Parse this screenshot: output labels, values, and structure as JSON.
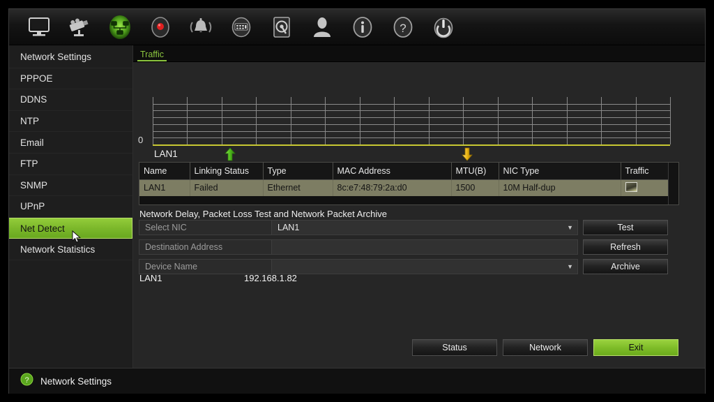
{
  "toolbar": {
    "icons": [
      {
        "name": "monitor-icon",
        "label": "Playback"
      },
      {
        "name": "camera-icon",
        "label": "Camera"
      },
      {
        "name": "network-icon",
        "label": "Network",
        "active": true,
        "accent": "#7ac943"
      },
      {
        "name": "record-icon",
        "label": "Record"
      },
      {
        "name": "alarm-bell-icon",
        "label": "Alarm"
      },
      {
        "name": "device-panel-icon",
        "label": "Device"
      },
      {
        "name": "hdd-icon",
        "label": "HDD"
      },
      {
        "name": "user-icon",
        "label": "User"
      },
      {
        "name": "info-icon",
        "label": "Information"
      },
      {
        "name": "help-icon",
        "label": "Help"
      },
      {
        "name": "power-icon",
        "label": "Shutdown"
      }
    ]
  },
  "sidebar": {
    "items": [
      {
        "label": "Network Settings",
        "active": false
      },
      {
        "label": "PPPOE",
        "active": false
      },
      {
        "label": "DDNS",
        "active": false
      },
      {
        "label": "NTP",
        "active": false
      },
      {
        "label": "Email",
        "active": false
      },
      {
        "label": "FTP",
        "active": false
      },
      {
        "label": "SNMP",
        "active": false
      },
      {
        "label": "UPnP",
        "active": false
      },
      {
        "label": "Net Detect",
        "active": true
      },
      {
        "label": "Network Statistics",
        "active": false
      }
    ],
    "active_color": "#7cb82b"
  },
  "tabs": [
    {
      "label": "Traffic",
      "active": true,
      "color": "#8cc63f"
    }
  ],
  "chart_data": {
    "type": "line",
    "title": "Traffic",
    "series": [
      {
        "name": "LAN1 sending",
        "arrow": "up",
        "color": "#5fc62b",
        "values": [
          0,
          0,
          0,
          0,
          0,
          0,
          0,
          0,
          0,
          0,
          0,
          0,
          0,
          0,
          0,
          0
        ]
      },
      {
        "name": "LAN1 receiving",
        "arrow": "down",
        "color": "#e3b617",
        "values": [
          0,
          0,
          0,
          0,
          0,
          0,
          0,
          0,
          0,
          0,
          0,
          0,
          0,
          0,
          0,
          0
        ]
      }
    ],
    "axis_label": "LAN1",
    "ytick_labels": [
      "0"
    ],
    "ylim": [
      0,
      7
    ],
    "grid": true,
    "grid_vertical_lines": 16,
    "grid_horizontal_lines": 7,
    "baseline_color": "#c8c832",
    "grid_color": "#8a8a8a",
    "legend_position": "below-axis"
  },
  "nic_table": {
    "headers": [
      "Name",
      "Linking Status",
      "Type",
      "MAC Address",
      "MTU(B)",
      "NIC Type",
      "Traffic"
    ],
    "rows": [
      {
        "name": "LAN1",
        "linking_status": "Failed",
        "type": "Ethernet",
        "mac_address": "8c:e7:48:79:2a:d0",
        "mtu": "1500",
        "nic_type": "10M Half-dup",
        "traffic_icon": "chart-thumbnail-icon"
      }
    ]
  },
  "form": {
    "section_title": "Network Delay, Packet Loss Test and Network Packet Archive",
    "fields": [
      {
        "label": "Select NIC",
        "value": "LAN1",
        "type": "select",
        "name": "select-nic"
      },
      {
        "label": "Destination Address",
        "value": "",
        "type": "text",
        "name": "destination-address"
      },
      {
        "label": "Device Name",
        "value": "",
        "type": "select",
        "name": "device-name"
      }
    ],
    "ip_row": {
      "nic": "LAN1",
      "address": "192.168.1.82"
    }
  },
  "side_buttons": [
    {
      "label": "Test",
      "name": "test-button"
    },
    {
      "label": "Refresh",
      "name": "refresh-button"
    },
    {
      "label": "Archive",
      "name": "archive-button"
    }
  ],
  "bottom_buttons": [
    {
      "label": "Status",
      "name": "status-button",
      "primary": false
    },
    {
      "label": "Network",
      "name": "network-button",
      "primary": false
    },
    {
      "label": "Exit",
      "name": "exit-button",
      "primary": true
    }
  ],
  "statusbar": {
    "icon": "help-circle-icon",
    "text": "Network Settings"
  }
}
